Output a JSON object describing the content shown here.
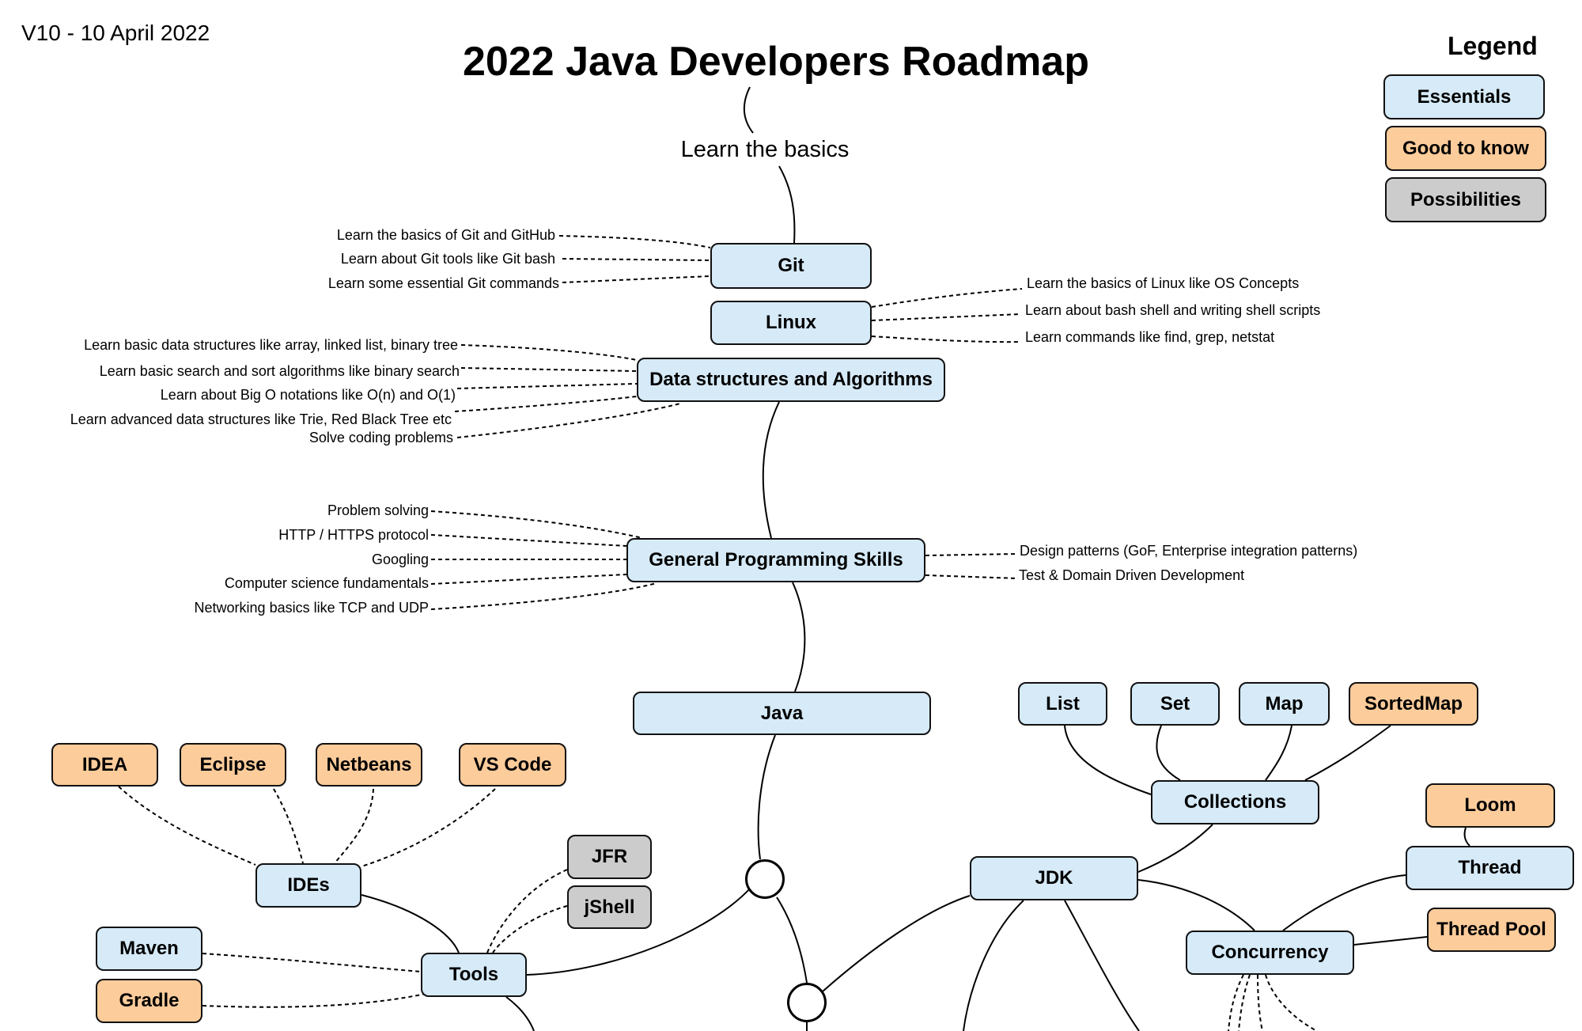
{
  "header": {
    "version": "V10 - 10 April 2022",
    "title": "2022 Java Developers Roadmap",
    "subtitle": "Learn the basics"
  },
  "legend": {
    "title": "Legend",
    "items": [
      {
        "label": "Essentials",
        "color": "#d6eaf8"
      },
      {
        "label": "Good to know",
        "color": "#fdcc9b"
      },
      {
        "label": "Possibilities",
        "color": "#cccccc"
      }
    ]
  },
  "colors": {
    "essential": "#d6eaf8",
    "good_to_know": "#fdcc9b",
    "possibility": "#cccccc",
    "stroke": "#111111"
  },
  "nodes": {
    "git": "Git",
    "linux": "Linux",
    "dsa": "Data structures and Algorithms",
    "gps": "General Programming Skills",
    "java": "Java",
    "list": "List",
    "set": "Set",
    "map": "Map",
    "sortedmap": "SortedMap",
    "collections": "Collections",
    "loom": "Loom",
    "thread": "Thread",
    "threadpool": "Thread Pool",
    "jdk": "JDK",
    "concurrency": "Concurrency",
    "idea": "IDEA",
    "eclipse": "Eclipse",
    "netbeans": "Netbeans",
    "vscode": "VS Code",
    "ides": "IDEs",
    "jfr": "JFR",
    "jshell": "jShell",
    "maven": "Maven",
    "gradle": "Gradle",
    "tools": "Tools"
  },
  "notes": {
    "git": [
      "Learn the basics of Git and GitHub",
      "Learn about Git tools like Git bash",
      "Learn some essential Git commands"
    ],
    "linux": [
      "Learn the basics of Linux like OS Concepts",
      "Learn about bash shell and writing shell scripts",
      "Learn commands like find, grep, netstat"
    ],
    "dsa": [
      "Learn basic data structures like array, linked list, binary tree",
      "Learn basic search and sort algorithms like binary search",
      "Learn about Big O notations like O(n) and O(1)",
      "Learn advanced data structures like Trie, Red Black Tree etc",
      "Solve coding problems"
    ],
    "gps_left": [
      "Problem solving",
      "HTTP / HTTPS protocol",
      "Googling",
      "Computer science fundamentals",
      "Networking basics like TCP and UDP"
    ],
    "gps_right": [
      "Design patterns (GoF, Enterprise integration patterns)",
      "Test & Domain Driven Development"
    ]
  }
}
